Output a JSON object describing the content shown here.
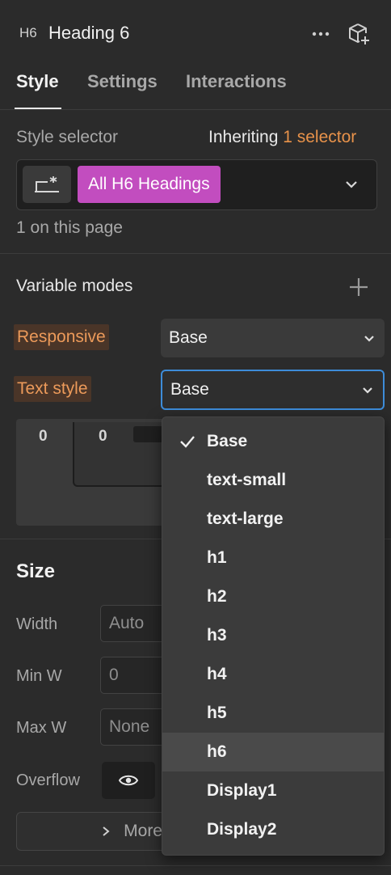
{
  "header": {
    "badge": "H6",
    "title": "Heading 6",
    "more_icon": "ellipsis-icon",
    "component_icon": "cube-plus-icon"
  },
  "tabs": [
    {
      "label": "Style",
      "active": true
    },
    {
      "label": "Settings",
      "active": false
    },
    {
      "label": "Interactions",
      "active": false
    }
  ],
  "style_selector": {
    "label": "Style selector",
    "inheriting_prefix": "Inheriting",
    "inheriting_count": "1 selector",
    "tag": "All H6 Headings",
    "tag_color": "#c24dbf",
    "on_page": "1 on this page"
  },
  "variable_modes": {
    "title": "Variable modes",
    "rows": [
      {
        "label": "Responsive",
        "value": "Base"
      },
      {
        "label": "Text style",
        "value": "Base"
      }
    ]
  },
  "spacing": {
    "values": [
      "0",
      "0"
    ]
  },
  "size": {
    "title": "Size",
    "rows": [
      {
        "label": "Width",
        "value": "Auto"
      },
      {
        "label": "Min W",
        "value": "0"
      },
      {
        "label": "Max W",
        "value": "None"
      }
    ],
    "overflow_label": "Overflow",
    "more_label": "More"
  },
  "dropdown": {
    "selected": "Base",
    "hovered": "h6",
    "options": [
      "Base",
      "text-small",
      "text-large",
      "h1",
      "h2",
      "h3",
      "h4",
      "h5",
      "h6",
      "Display1",
      "Display2"
    ]
  },
  "colors": {
    "accent": "#e8924a",
    "focus": "#3d8cd9",
    "background": "#2b2b2b"
  }
}
